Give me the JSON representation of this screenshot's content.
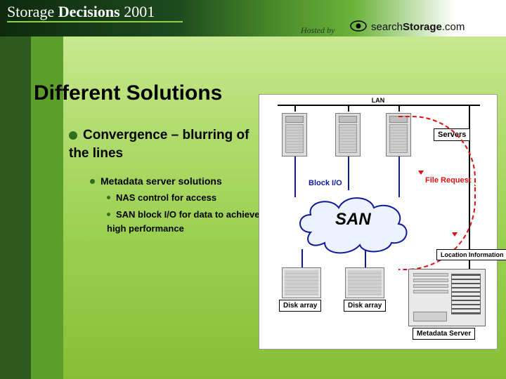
{
  "header": {
    "brand_prefix": "Storage",
    "brand_bold": "Decisions",
    "brand_year": "2001",
    "hosted_by": "Hosted by",
    "sponsor_prefix": "search",
    "sponsor_bold": "Storage",
    "sponsor_suffix": ".com"
  },
  "slide": {
    "title": "Different Solutions",
    "bullets": {
      "main": "Convergence – blurring of the lines",
      "sub1": "Metadata server solutions",
      "sub2a": "NAS control for access",
      "sub2b": "SAN block I/O for data to achieve high performance"
    }
  },
  "diagram": {
    "lan": "LAN",
    "servers_label": "Servers",
    "block_io": "Block I/O",
    "file_request": "File Request",
    "san": "SAN",
    "location_info": "Location Information",
    "disk_array1": "Disk array",
    "disk_array2": "Disk array",
    "metadata_server": "Metadata Server"
  }
}
